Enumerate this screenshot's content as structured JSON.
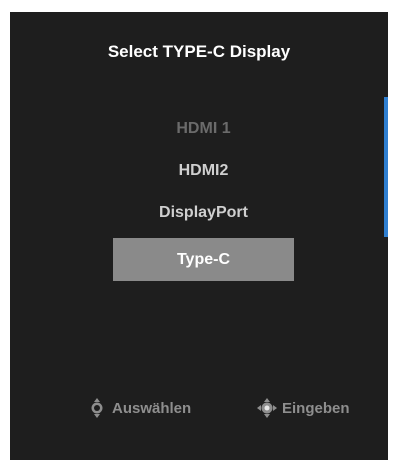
{
  "menu": {
    "title": "Select TYPE-C Display",
    "options": [
      {
        "label": "HDMI 1",
        "state": "disabled"
      },
      {
        "label": "HDMI2",
        "state": "normal"
      },
      {
        "label": "DisplayPort",
        "state": "normal"
      },
      {
        "label": "Type-C",
        "state": "selected"
      }
    ]
  },
  "footer": {
    "select_label": "Auswählen",
    "enter_label": "Eingeben"
  },
  "icons": {
    "select": "joystick-updown-icon",
    "enter": "joystick-press-icon"
  },
  "colors": {
    "panel_background": "#1e1e1e",
    "highlight": "#8a8a8a",
    "scroll_indicator": "#2f7fd1",
    "disabled_text": "#6b6b6b"
  }
}
